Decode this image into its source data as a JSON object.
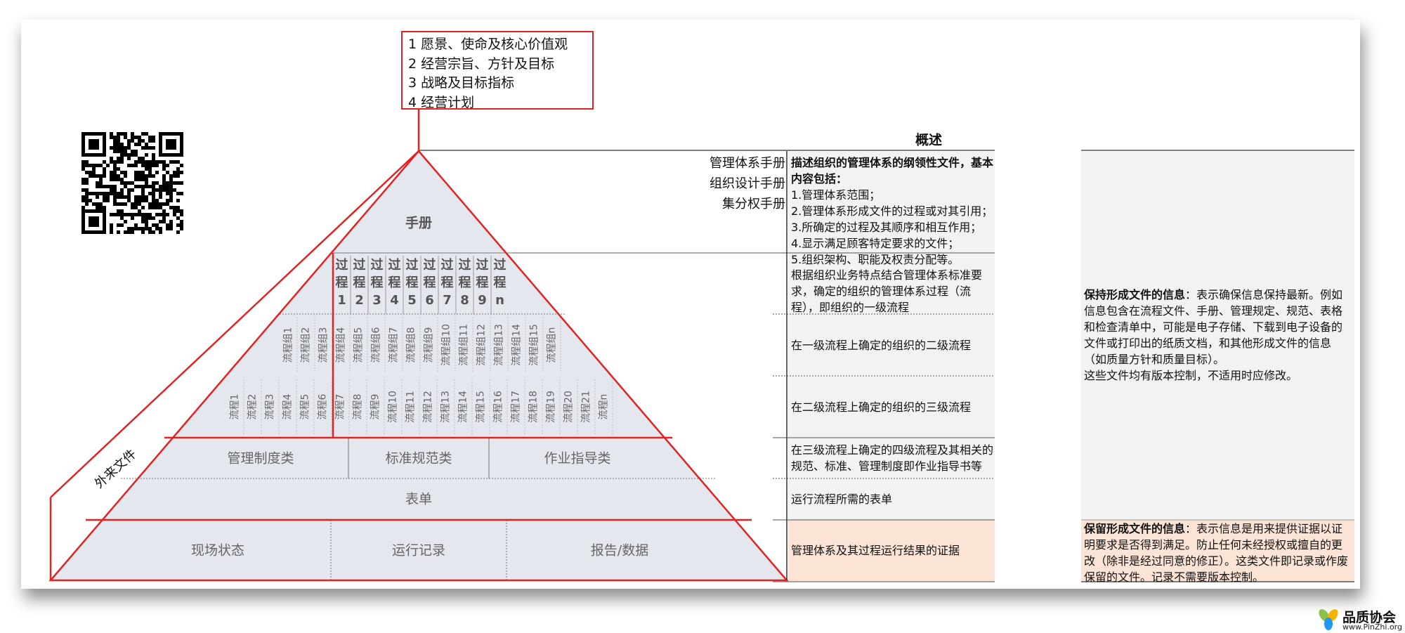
{
  "goals": [
    "1 愿景、使命及核心价值观",
    "2 经营宗旨、方针及目标",
    "3 战略及目标指标",
    "4 经营计划"
  ],
  "overview_header": "概述",
  "manual_titles": [
    "管理体系手册",
    "组织设计手册",
    "集分权手册"
  ],
  "pyramid": {
    "handbook": "手册",
    "processes": [
      "过程1",
      "过程2",
      "过程3",
      "过程4",
      "过程5",
      "过程6",
      "过程7",
      "过程8",
      "过程9",
      "过程n"
    ],
    "groups": [
      "流程组1",
      "流程组2",
      "流程组3",
      "流程组4",
      "流程组5",
      "流程组6",
      "流程组7",
      "流程组8",
      "流程组9",
      "流程组10",
      "流程组11",
      "流程组12",
      "流程组13",
      "流程组14",
      "流程组15",
      "流程组n"
    ],
    "flows": [
      "流程1",
      "流程2",
      "流程3",
      "流程4",
      "流程5",
      "流程6",
      "流程7",
      "流程8",
      "流程9",
      "流程10",
      "流程11",
      "流程12",
      "流程13",
      "流程14",
      "流程15",
      "流程16",
      "流程17",
      "流程18",
      "流程19",
      "流程20",
      "流程21",
      "流程n"
    ],
    "level4": [
      "管理制度类",
      "标准规范类",
      "作业指导类"
    ],
    "forms": "表单",
    "records": [
      "现场状态",
      "运行记录",
      "报告/数据"
    ],
    "external": "外来文件"
  },
  "descriptions": {
    "manual_title": "描述组织的管理体系的纲领性文件，基本内容包括：",
    "manual_items": [
      "1.管理体系范围；",
      "2.管理体系形成文件的过程或对其引用；",
      "3.所确定的过程及其顺序和相互作用；",
      "4.显示满足顾客特定要求的文件；",
      "5.组织架构、职能及权责分配等。"
    ],
    "level1": "根据组织业务特点结合管理体系标准要求，确定的组织的管理体系过程（流程），即组织的一级流程",
    "level2": "在一级流程上确定的组织的二级流程",
    "level3": "在二级流程上确定的组织的三级流程",
    "level4": "在三级流程上确定的四级流程及其相关的规范、标准、管理制度即作业指导书等",
    "forms": "运行流程所需的表单",
    "records": "管理体系及其过程运行结果的证据"
  },
  "maintain": {
    "title": "保持形成文件的信息",
    "text": "：表示确保信息保持最新。例如信息包含在流程文件、手册、管理规定、规范、表格和检查清单中，可能是电子存储、下载到电子设备的文件或打印出的纸质文档，和其他形成文件的信息（如质量方针和质量目标）。",
    "note": "这些文件均有版本控制，不适用时应修改。"
  },
  "retain": {
    "title": "保留形成文件的信息",
    "text": "：表示信息是用来提供证据以证明要求是否得到满足。防止任何未经授权或擅自的更改（除非是经过同意的修正）。这类文件即记录或作废保留的文件。记录不需要版本控制。"
  },
  "logo": {
    "name": "品质协会",
    "url": "www.PinZhi.org"
  },
  "colors": {
    "red": "#e02424",
    "pyramid_fill": "#e4e7ee",
    "cell_fill": "#f2f2f2",
    "retain_fill": "#fbe4d5"
  }
}
